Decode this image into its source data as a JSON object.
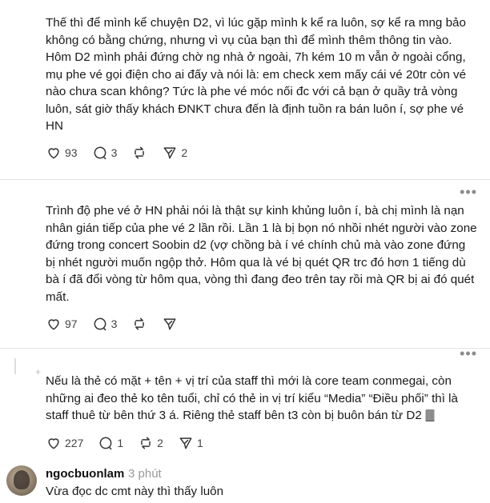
{
  "posts": [
    {
      "text": "Thế thì để mình kể chuyện D2, vì lúc gặp mình k kể ra luôn, sợ kể ra mng bảo không có bằng chứng, nhưng vì vụ của bạn thì để mình thêm thông tin vào. Hôm D2 mình phải đứng chờ ng nhà ở ngoài, 7h kém 10 m vẫn ở ngoài cổng, mụ phe vé gọi điện cho ai đấy và nói là: em check xem mấy cái vé 20tr còn vé nào chưa scan không? Tức là phe vé móc nối đc với cả bạn ở quầy trả vòng luôn, sát giờ thấy khách ĐNKT chưa đến là định tuồn ra bán luôn í, sợ phe vé HN",
      "likes": "93",
      "comments": "3",
      "reposts": "",
      "shares": "2"
    },
    {
      "text": "Trình độ phe vé ở HN phải nói là thật sự kinh khủng luôn í, bà chị mình là nạn nhân gián tiếp của phe vé 2 lần rồi. Lần 1 là bị bọn nó nhồi nhét người vào zone đứng trong concert Soobin d2 (vợ chồng bà í vé chính chủ mà vào zone đứng bị nhét người muốn ngộp thở. Hôm qua là vé bị quét QR trc đó hơn 1 tiếng dù bà í đã đổi vòng từ hôm qua, vòng thì đang đeo trên tay rồi mà QR bị ai đó quét mất.",
      "likes": "97",
      "comments": "3",
      "reposts": "",
      "shares": ""
    },
    {
      "text": "Nếu là thẻ có mặt + tên + vị trí của staff thì mới là core team conmegai, còn những ai đeo thẻ ko tên tuổi, chỉ có thẻ in vị trí kiểu “Media” “Điều phối” thì là staff thuê từ bên thứ 3 á. Riêng thẻ staff bên t3 còn bị buôn bán từ D2 🀫",
      "likes": "227",
      "comments": "1",
      "reposts": "2",
      "shares": "1"
    }
  ],
  "reply": {
    "username": "ngocbuonlam",
    "time": "3 phút",
    "text": "Vừa đọc dc cmt này thì thấy luôn"
  },
  "icons": {
    "more": "more-icon",
    "like": "heart-icon",
    "comment": "comment-icon",
    "repost": "repost-icon",
    "share": "share-icon"
  }
}
